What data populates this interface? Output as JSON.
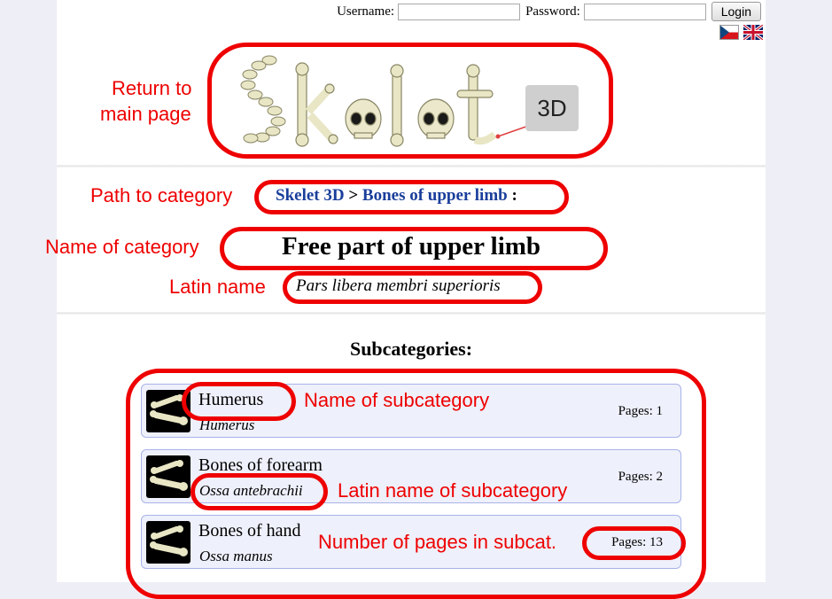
{
  "login": {
    "username_label": "Username:",
    "password_label": "Password:",
    "username_value": "",
    "password_value": "",
    "login_button": "Login"
  },
  "flags": [
    "czech-flag",
    "uk-flag"
  ],
  "logo": {
    "text": "Skelet",
    "badge": "3D"
  },
  "breadcrumb": {
    "root": "Skelet 3D",
    "sep": ">",
    "parent": "Bones of upper limb",
    "tail": " :"
  },
  "category": {
    "name": "Free part of upper limb",
    "latin": "Pars libera membri superioris"
  },
  "subcategories_title": "Subcategories:",
  "subcategories": [
    {
      "name": "Humerus",
      "latin": "Humerus",
      "pages": "Pages: 1"
    },
    {
      "name": "Bones of forearm",
      "latin": "Ossa antebrachii",
      "pages": "Pages: 2"
    },
    {
      "name": "Bones of hand",
      "latin": "Ossa manus",
      "pages": "Pages: 13"
    }
  ],
  "annotations": {
    "return_main_line1": "Return to",
    "return_main_line2": "main page",
    "path_to_category": "Path to category",
    "name_of_category": "Name of category",
    "latin_name": "Latin name",
    "name_of_subcategory": "Name of subcategory",
    "latin_name_of_subcategory": "Latin name of subcategory",
    "number_of_pages": "Number of pages in subcat."
  },
  "colors": {
    "annotation": "#ee0000",
    "link": "#1a3f9b",
    "card_bg": "#eef0fb",
    "card_border": "#a8b3e8",
    "bone": "#e8e6c4"
  }
}
